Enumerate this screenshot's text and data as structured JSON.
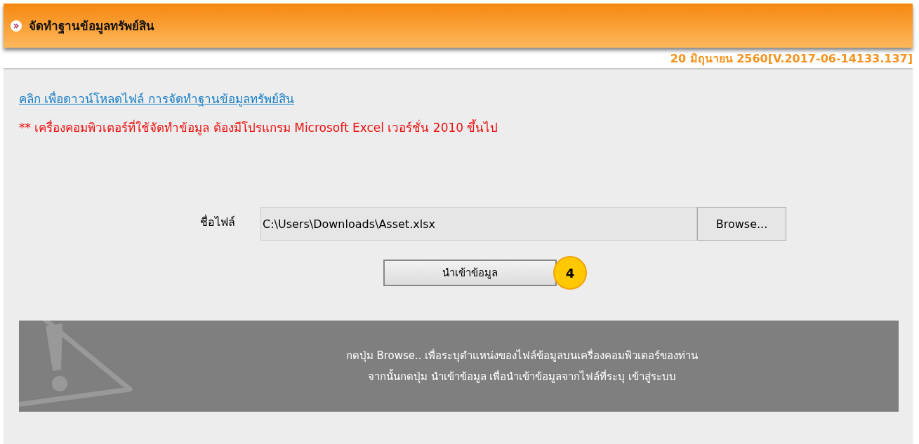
{
  "header": {
    "title": "จัดทำฐานข้อมูลทรัพย์สิน"
  },
  "version": "20 มิถุนายน 2560[V.2017-06-14133.137]",
  "download_link": "คลิก เพื่อดาวน์โหลดไฟล์ การจัดทำฐานข้อมูลทรัพย์สิน",
  "requirement_note": "** เครื่องคอมพิวเตอร์ที่ใช้จัดทำข้อมูล ต้องมีโปรแกรม Microsoft Excel เวอร์ชั่น 2010 ขึ้นไป",
  "file_field": {
    "label": "ชื่อไฟล์",
    "value": "C:\\Users\\Downloads\\Asset.xlsx",
    "browse_button": "Browse..."
  },
  "import_button": "นำเข้าข้อมูล",
  "step_badge": "4",
  "info_lines": [
    "กดปุ่ม Browse.. เพื่อระบุตำแหน่งของไฟล์ข้อมูลบนเครื่องคอมพิวเตอร์ของท่าน",
    "จากนั้นกดปุ่ม นำเข้าข้อมูล เพื่อนำเข้าข้อมูลจากไฟล์ที่ระบุ เข้าสู่ระบบ"
  ]
}
